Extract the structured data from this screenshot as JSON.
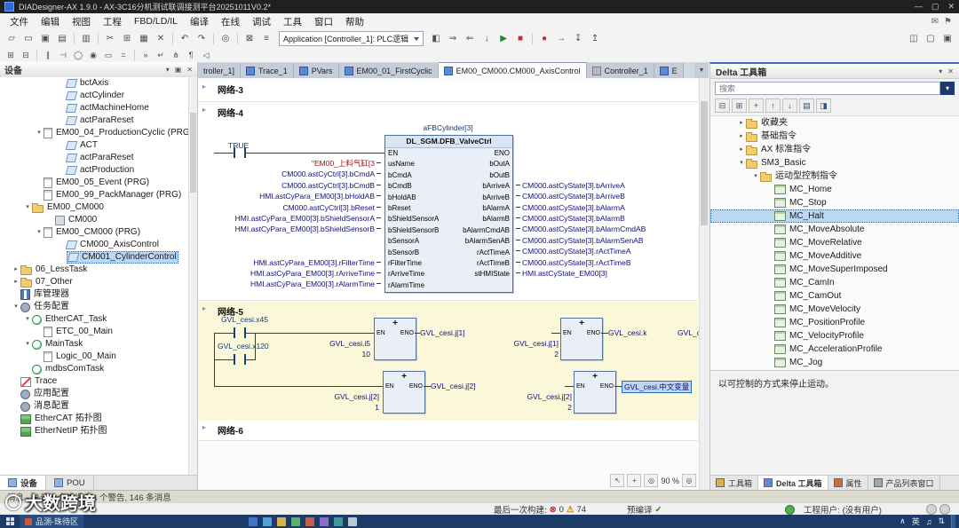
{
  "window": {
    "title": "DIADesigner-AX 1.9.0 - AX-3C16分机测试联调接测平台20251011V0.2*",
    "controls": [
      {
        "name": "minimize-button",
        "glyph": "—"
      },
      {
        "name": "maximize-button",
        "glyph": "▢"
      },
      {
        "name": "close-button",
        "glyph": "✕"
      }
    ]
  },
  "menu": {
    "items": [
      "文件",
      "编辑",
      "视图",
      "工程",
      "FBD/LD/IL",
      "编译",
      "在线",
      "调试",
      "工具",
      "窗口",
      "帮助"
    ],
    "right_icons": [
      {
        "name": "message-icon",
        "glyph": "✉"
      },
      {
        "name": "flag-icon",
        "glyph": "⚑"
      }
    ]
  },
  "toolbar": {
    "application_selector": "Application [Controller_1]: PLC逻辑",
    "main_icons_a": [
      {
        "n": "new-project-icon",
        "g": "▱"
      },
      {
        "n": "open-project-icon",
        "g": "▭"
      },
      {
        "n": "save-icon",
        "g": "▣"
      },
      {
        "n": "save-all-icon",
        "g": "▤"
      },
      {
        "n": "print-icon",
        "g": "▥"
      },
      {
        "n": "cut-icon",
        "g": "✂"
      },
      {
        "n": "copy-icon",
        "g": "⊞"
      },
      {
        "n": "paste-icon",
        "g": "▦"
      },
      {
        "n": "delete-icon",
        "g": "✕"
      },
      {
        "n": "undo-icon",
        "g": "↶"
      },
      {
        "n": "redo-icon",
        "g": "↷"
      },
      {
        "n": "find-icon",
        "g": "◎"
      },
      {
        "n": "build-icon",
        "g": "⊠"
      },
      {
        "n": "generate-code-icon",
        "g": "≡"
      }
    ],
    "main_icons_b": [
      {
        "n": "gateway-icon",
        "g": "◧"
      },
      {
        "n": "login-icon",
        "g": "⇒"
      },
      {
        "n": "logout-icon",
        "g": "⇐"
      },
      {
        "n": "download-icon",
        "g": "↓"
      },
      {
        "n": "start-icon",
        "g": "▶"
      },
      {
        "n": "stop-icon",
        "g": "■"
      },
      {
        "n": "breakpoint-icon",
        "g": "●"
      },
      {
        "n": "step-over-icon",
        "g": "→"
      },
      {
        "n": "step-into-icon",
        "g": "↧"
      },
      {
        "n": "step-out-icon",
        "g": "↥"
      }
    ],
    "window_icons": [
      {
        "n": "window-split-icon",
        "g": "◫"
      },
      {
        "n": "window-layout-icon",
        "g": "▢"
      },
      {
        "n": "window-full-icon",
        "g": "▣"
      }
    ],
    "ld_icons": [
      {
        "n": "insert-network-icon",
        "g": "⊞"
      },
      {
        "n": "insert-network-below-icon",
        "g": "⊟"
      },
      {
        "n": "contact-icon",
        "g": "∥"
      },
      {
        "n": "negated-contact-icon",
        "g": "⊣"
      },
      {
        "n": "coil-icon",
        "g": "◯"
      },
      {
        "n": "set-coil-icon",
        "g": "◉"
      },
      {
        "n": "function-block-box-icon",
        "g": "▭"
      },
      {
        "n": "assignment-icon",
        "g": "="
      },
      {
        "n": "jump-icon",
        "g": "»"
      },
      {
        "n": "return-icon",
        "g": "↵"
      },
      {
        "n": "branch-icon",
        "g": "⋔"
      },
      {
        "n": "comment-icon",
        "g": "¶"
      },
      {
        "n": "input-assistant-icon",
        "g": "◁"
      }
    ]
  },
  "device_panel": {
    "title": "设备",
    "header_icons": [
      {
        "name": "dropdown-icon",
        "glyph": "▾"
      },
      {
        "name": "dock-icon",
        "glyph": "▣"
      },
      {
        "name": "close-icon",
        "glyph": "✕"
      }
    ],
    "bottom_tabs": [
      {
        "label": "设备"
      },
      {
        "label": "POU"
      }
    ],
    "tree": [
      {
        "label": "bctAxis",
        "lvl": 5,
        "icon": "action-icon",
        "arrow": ""
      },
      {
        "label": "actCylinder",
        "lvl": 5,
        "icon": "action-icon",
        "arrow": ""
      },
      {
        "label": "actMachineHome",
        "lvl": 5,
        "icon": "action-icon",
        "arrow": ""
      },
      {
        "label": "actParaReset",
        "lvl": 5,
        "icon": "action-icon",
        "arrow": ""
      },
      {
        "label": "EM00_04_ProductionCyclic (PRG)",
        "lvl": 3,
        "icon": "pou-icon",
        "arrow": "▾"
      },
      {
        "label": "ACT",
        "lvl": 5,
        "icon": "action-icon",
        "arrow": ""
      },
      {
        "label": "actParaReset",
        "lvl": 5,
        "icon": "action-icon",
        "arrow": ""
      },
      {
        "label": "actProduction",
        "lvl": 5,
        "icon": "action-icon",
        "arrow": ""
      },
      {
        "label": "EM00_05_Event (PRG)",
        "lvl": 3,
        "icon": "pou-icon",
        "arrow": ""
      },
      {
        "label": "EM00_99_PackManager (PRG)",
        "lvl": 3,
        "icon": "pou-icon",
        "arrow": ""
      },
      {
        "label": "EM00_CM000",
        "lvl": 2,
        "icon": "folder-icon",
        "arrow": "▾"
      },
      {
        "label": "CM000",
        "lvl": 4,
        "icon": "object-icon",
        "arrow": ""
      },
      {
        "label": "EM00_CM000 (PRG)",
        "lvl": 3,
        "icon": "pou-icon",
        "arrow": "▾"
      },
      {
        "label": "CM000_AxisControl",
        "lvl": 5,
        "icon": "action-icon",
        "arrow": ""
      },
      {
        "label": "CM001_CylinderControl",
        "lvl": 5,
        "icon": "action-icon",
        "arrow": "",
        "selected": true
      },
      {
        "label": "06_LessTask",
        "lvl": 1,
        "icon": "folder-icon",
        "arrow": "▸"
      },
      {
        "label": "07_Other",
        "lvl": 1,
        "icon": "folder-icon",
        "arrow": "▸"
      },
      {
        "label": "库管理器",
        "lvl": 1,
        "icon": "library-icon",
        "arrow": ""
      },
      {
        "label": "任务配置",
        "lvl": 1,
        "icon": "task-config-icon",
        "arrow": "▾"
      },
      {
        "label": "EtherCAT_Task",
        "lvl": 2,
        "icon": "task-icon",
        "arrow": "▾"
      },
      {
        "label": "ETC_00_Main",
        "lvl": 3,
        "icon": "pou-ref-icon",
        "arrow": ""
      },
      {
        "label": "MainTask",
        "lvl": 2,
        "icon": "task-icon",
        "arrow": "▾"
      },
      {
        "label": "Logic_00_Main",
        "lvl": 3,
        "icon": "pou-ref-icon",
        "arrow": ""
      },
      {
        "label": "mdbsComTask",
        "lvl": 2,
        "icon": "task-icon",
        "arrow": ""
      },
      {
        "label": "Trace",
        "lvl": 1,
        "icon": "trace-icon",
        "arrow": ""
      },
      {
        "label": "应用配置",
        "lvl": 1,
        "icon": "config-icon",
        "arrow": ""
      },
      {
        "label": "消息配置",
        "lvl": 1,
        "icon": "config-icon",
        "arrow": ""
      },
      {
        "label": "EtherCAT 拓扑图",
        "lvl": 1,
        "icon": "topology-icon",
        "arrow": ""
      },
      {
        "label": "EtherNetIP 拓扑图",
        "lvl": 1,
        "icon": "topology-icon",
        "arrow": ""
      }
    ]
  },
  "editor": {
    "tabs": [
      {
        "label": "troller_1]"
      },
      {
        "label": "Trace_1"
      },
      {
        "label": "PVars"
      },
      {
        "label": "EM00_01_FirstCyclic"
      },
      {
        "label": "EM00_CM000.CM000_AxisControl",
        "active": true
      },
      {
        "label": "Controller_1"
      },
      {
        "label": "E"
      }
    ],
    "overflow_glyph": "▼",
    "net3_label": "网络-3",
    "net6_label": "网络-6",
    "gutter_glyph": "▸",
    "net4": {
      "label": "网络-4",
      "contact": "TRUE",
      "instance": "aFBCylinder[3]",
      "type": "DL_SGM.DFB_ValveCtrl",
      "left_pins": [
        "EN",
        "usName",
        "bCmdA",
        "bCmdB",
        "bHoldAB",
        "bReset",
        "bShieldSensorA",
        "bShieldSensorB",
        "bSensorA",
        "bSensorB",
        "rFilterTime",
        "rArriveTime",
        "rAlarmTime"
      ],
      "right_pins": [
        "ENO",
        "bOutA",
        "bOutB",
        "bArriveA",
        "bArriveB",
        "bAlarmA",
        "bAlarmB",
        "bAlarmCmdAB",
        "bAlarmSenAB",
        "rActTimeA",
        "rActTimeB",
        "stHMIState"
      ],
      "left_operands": [
        "\"EM00_上料气缸[3",
        "CM000.astCyCtrl[3].bCmdA",
        "CM000.astCyCtrl[3].bCmdB",
        "HMI.astCyPara_EM00[3].bHoldAB",
        "CM000.astCyCtrl[3].bReset",
        "HMI.astCyPara_EM00[3].bShieldSensorA",
        "HMI.astCyPara_EM00[3].bShieldSensorB",
        "",
        "",
        "HMI.astCyPara_EM00[3].rFilterTime",
        "HMI.astCyPara_EM00[3].rArriveTime",
        "HMI.astCyPara_EM00[3].rAlarmTime"
      ],
      "right_operands": [
        "",
        "",
        "CM000.astCyState[3].bArriveA",
        "CM000.astCyState[3].bArriveB",
        "CM000.astCyState[3].bAlarmA",
        "CM000.astCyState[3].bAlarmB",
        "CM000.astCyState[3].bAlarmCmdAB",
        "CM000.astCyState[3].bAlarmSenAB",
        "CM000.astCyState[3].rActTimeA",
        "CM000.astCyState[3].rActTimeB",
        "HMI.astCyState_EM00[3]"
      ]
    },
    "net5": {
      "label": "网络-5",
      "contact1": "GVL_cesi.x45",
      "contact2": "GVL_cesi.x120",
      "op": "+",
      "en": "EN",
      "eno": "ENO",
      "r1b1_in1": "GVL_cesi.i5",
      "r1b1_in2": "10",
      "r1b1_out": "GVL_cesi.j[1]",
      "r1b2_in1": "GVL_cesi.j[1]",
      "r1b2_in2": "2",
      "r1b2_out": "GVL_cesi.k",
      "r1b2_out2": "GVL_ces",
      "r2b1_in1": "GVL_cesi.j[2]",
      "r2b1_in2": "1",
      "r2b1_out": "GVL_cesi.j[2]",
      "r2b2_in1": "GVL_cesi.j[2]",
      "r2b2_in2": "2",
      "r2b2_out": "GVL_cesi.中文变量"
    },
    "zoom": "90 %",
    "zoom_icons": [
      {
        "name": "select-mode-icon",
        "glyph": "↖"
      },
      {
        "name": "pan-icon",
        "glyph": "+"
      },
      {
        "name": "zoom-in-icon",
        "glyph": "◎"
      },
      {
        "name": "zoom-menu-icon",
        "glyph": "◎"
      }
    ]
  },
  "toolbox_panel": {
    "title": "Delta 工具箱",
    "header_icons": [
      {
        "name": "dropdown-icon",
        "glyph": "▾"
      },
      {
        "name": "close-icon",
        "glyph": "✕"
      }
    ],
    "search_placeholder": "搜索",
    "toolbar_icons": [
      {
        "name": "collapse-all-icon",
        "glyph": "⊟"
      },
      {
        "name": "expand-all-icon",
        "glyph": "⊞"
      },
      {
        "name": "add-favorite-icon",
        "glyph": "+"
      },
      {
        "name": "move-up-icon",
        "glyph": "↑"
      },
      {
        "name": "move-down-icon",
        "glyph": "↓"
      },
      {
        "name": "view-mode-icon",
        "glyph": "▤"
      },
      {
        "name": "pin-icon",
        "glyph": "◨"
      }
    ],
    "tree": [
      {
        "label": "收藏夹",
        "lvl": 0,
        "icon": "folder-icon",
        "arrow": "▸"
      },
      {
        "label": "基础指令",
        "lvl": 0,
        "icon": "folder-icon",
        "arrow": "▸"
      },
      {
        "label": "AX 标准指令",
        "lvl": 0,
        "icon": "folder-icon",
        "arrow": "▸"
      },
      {
        "label": "SM3_Basic",
        "lvl": 0,
        "icon": "folder-icon",
        "arrow": "▾"
      },
      {
        "label": "运动型控制指令",
        "lvl": 1,
        "icon": "folder-icon",
        "arrow": "▾"
      },
      {
        "label": "MC_Home",
        "lvl": 2,
        "icon": "function-block-icon",
        "arrow": ""
      },
      {
        "label": "MC_Stop",
        "lvl": 2,
        "icon": "function-block-icon",
        "arrow": ""
      },
      {
        "label": "MC_Halt",
        "lvl": 2,
        "icon": "function-block-icon",
        "arrow": "",
        "selected": true
      },
      {
        "label": "MC_MoveAbsolute",
        "lvl": 2,
        "icon": "function-block-icon",
        "arrow": ""
      },
      {
        "label": "MC_MoveRelative",
        "lvl": 2,
        "icon": "function-block-icon",
        "arrow": ""
      },
      {
        "label": "MC_MoveAdditive",
        "lvl": 2,
        "icon": "function-block-icon",
        "arrow": ""
      },
      {
        "label": "MC_MoveSuperImposed",
        "lvl": 2,
        "icon": "function-block-icon",
        "arrow": ""
      },
      {
        "label": "MC_CamIn",
        "lvl": 2,
        "icon": "function-block-icon",
        "arrow": ""
      },
      {
        "label": "MC_CamOut",
        "lvl": 2,
        "icon": "function-block-icon",
        "arrow": ""
      },
      {
        "label": "MC_MoveVelocity",
        "lvl": 2,
        "icon": "function-block-icon",
        "arrow": ""
      },
      {
        "label": "MC_PositionProfile",
        "lvl": 2,
        "icon": "function-block-icon",
        "arrow": ""
      },
      {
        "label": "MC_VelocityProfile",
        "lvl": 2,
        "icon": "function-block-icon",
        "arrow": ""
      },
      {
        "label": "MC_AccelerationProfile",
        "lvl": 2,
        "icon": "function-block-icon",
        "arrow": ""
      },
      {
        "label": "MC_Jog",
        "lvl": 2,
        "icon": "function-block-icon",
        "arrow": ""
      }
    ],
    "description": "以可控制的方式来停止运动。",
    "bottom_tabs": [
      {
        "label": "工具箱"
      },
      {
        "label": "Delta 工具箱",
        "active": true
      },
      {
        "label": "属性"
      },
      {
        "label": "产品列表窗口"
      }
    ]
  },
  "message_bar": {
    "text": "消息 - 总计 0 个错误, 74 个警告, 146 条消息"
  },
  "status_bar": {
    "last_build": "最后一次构建:",
    "error_icon": "⊗",
    "errors": "0",
    "warning_icon": "⚠",
    "warnings": "74",
    "precompile": "预编译",
    "check": "✓",
    "user_label": "工程用户:",
    "user_value": "(没有用户)"
  },
  "watermark": {
    "text": "大数跨境"
  },
  "taskbar": {
    "app_label": "品测-珠待区",
    "tray_up": "∧",
    "ime": "英",
    "tray_icons": [
      {
        "name": "volume-icon",
        "glyph": "♫"
      },
      {
        "name": "network-icon",
        "glyph": "⇅"
      }
    ]
  }
}
